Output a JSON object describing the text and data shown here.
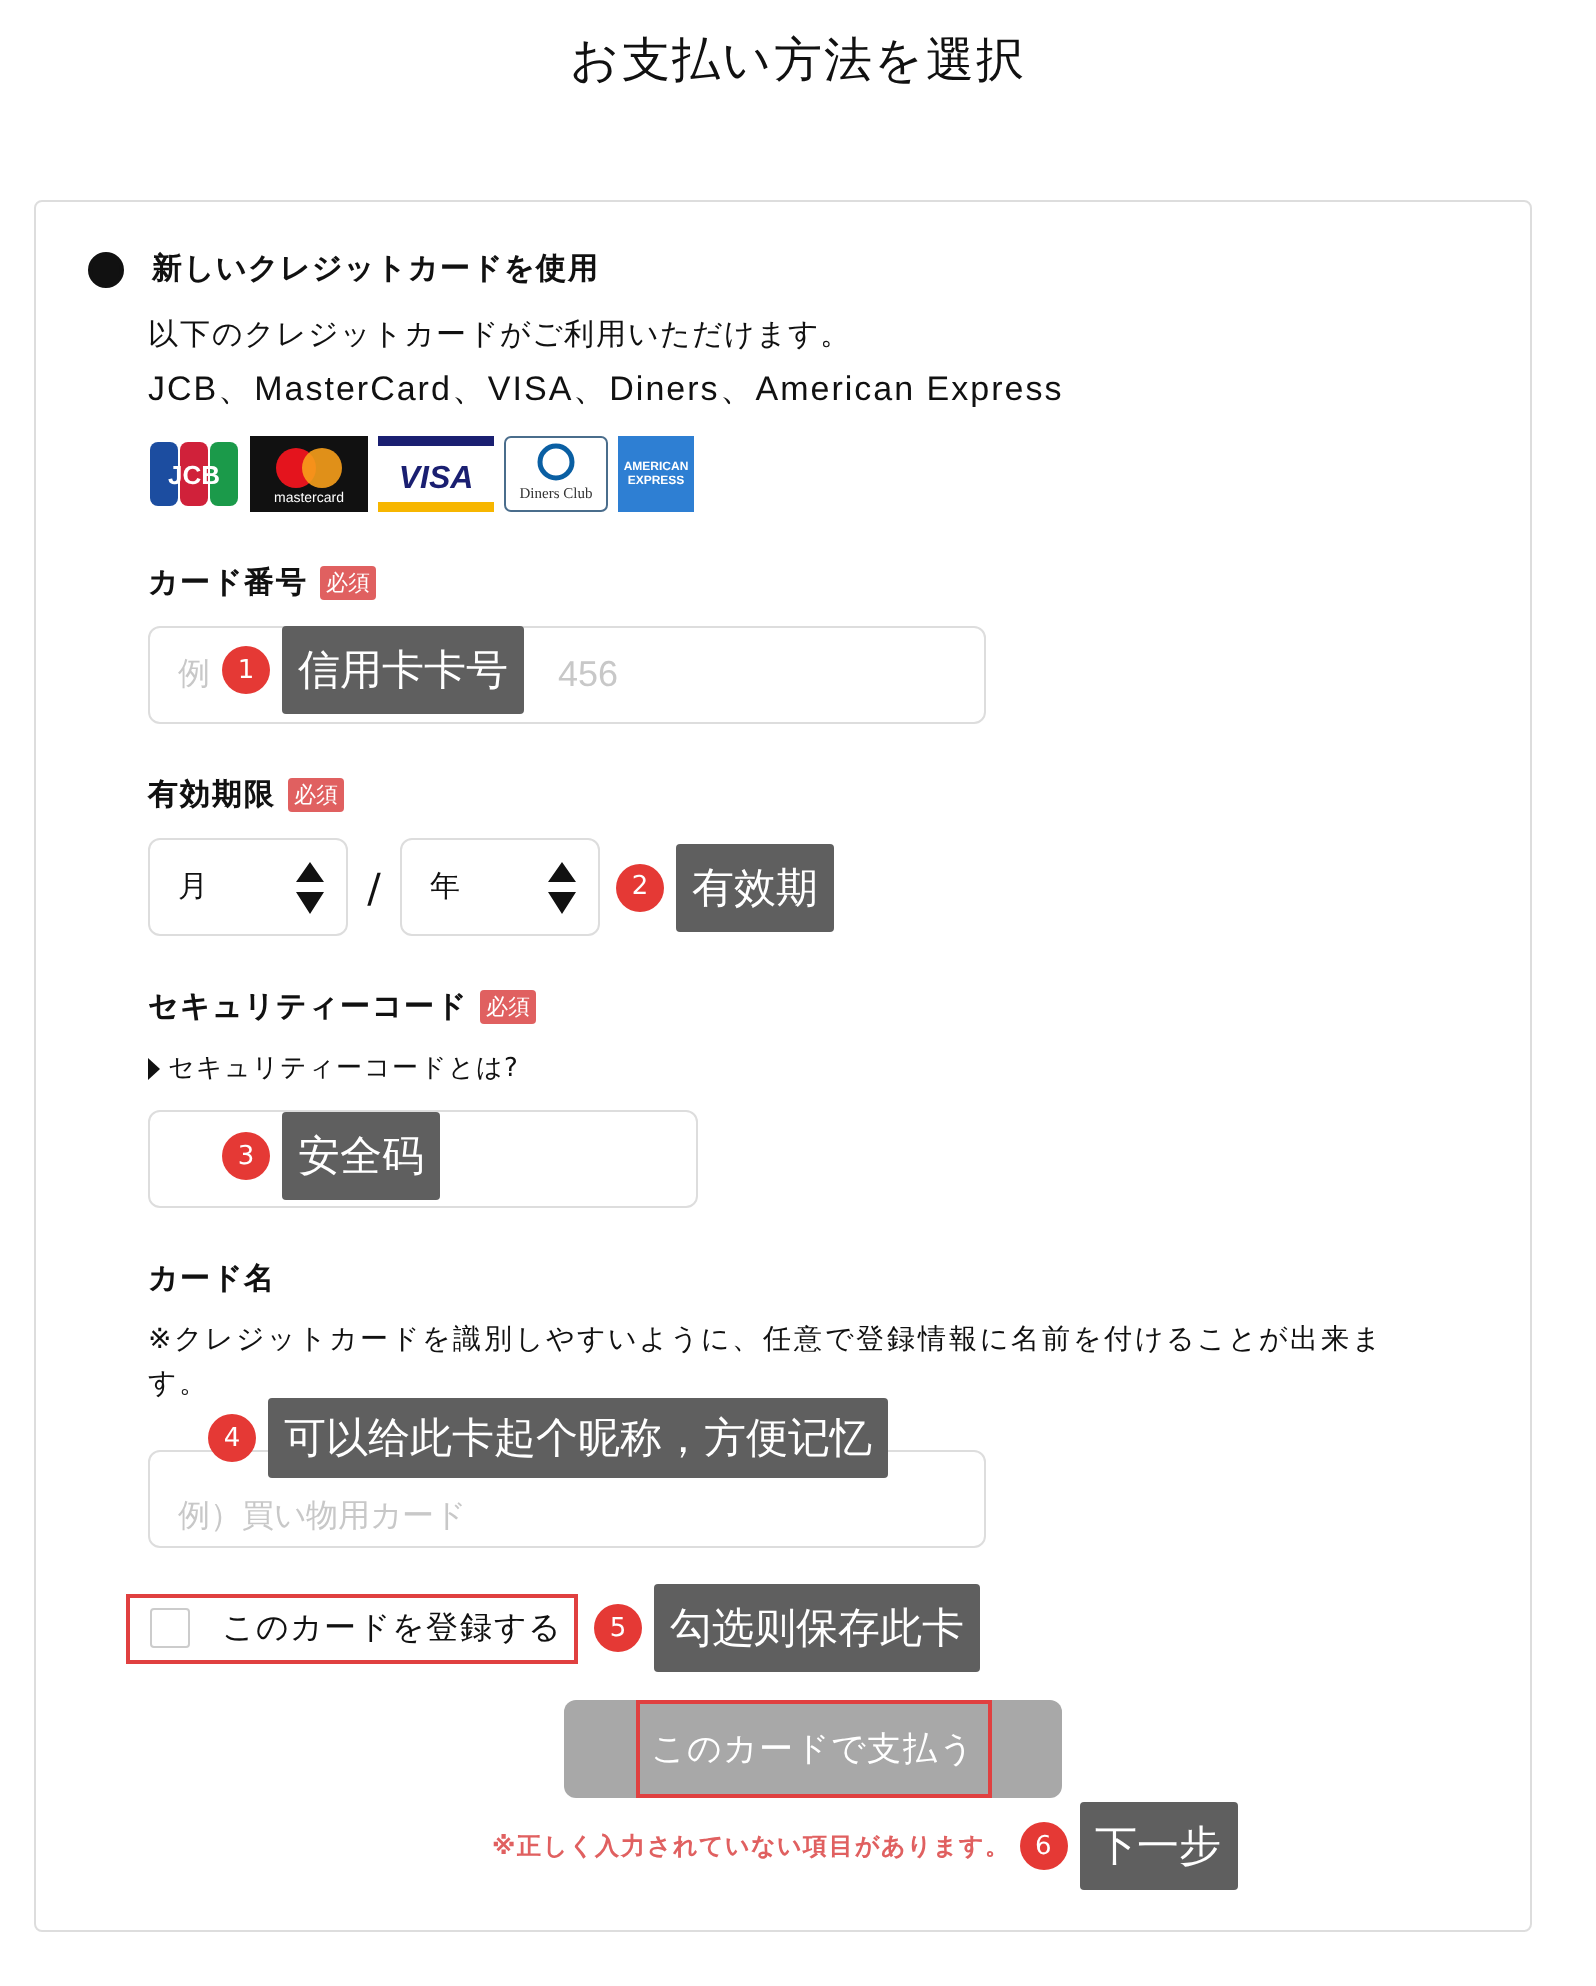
{
  "page_title": "お支払い方法を選択",
  "payment_option": {
    "label": "新しいクレジットカードを使用",
    "selected": true
  },
  "accepted_note": "以下のクレジットカードがご利用いただけます。",
  "accepted_brands": "JCB、MasterCard、VISA、Diners、American Express",
  "card_logos": [
    {
      "kind": "jcb",
      "text": "JCB"
    },
    {
      "kind": "mastercard",
      "text": "mastercard"
    },
    {
      "kind": "visa",
      "text": "VISA"
    },
    {
      "kind": "diners",
      "text": "Diners Club"
    },
    {
      "kind": "amex",
      "text": "AMERICAN EXPRESS"
    }
  ],
  "card_number": {
    "label": "カード番号",
    "badge": "必須",
    "placeholder_parts": [
      "例",
      "456"
    ]
  },
  "expiry": {
    "label": "有効期限",
    "badge": "必須",
    "month": "月",
    "separator": "/",
    "year": "年"
  },
  "security_code": {
    "label": "セキュリティーコード",
    "badge": "必須",
    "help_link": "セキュリティーコードとは?"
  },
  "card_name": {
    "label": "カード名",
    "note": "※クレジットカードを識別しやすいように、任意で登録情報に名前を付けることが出来ます。",
    "placeholder": "例）買い物用カード"
  },
  "save_card": {
    "label": "このカードを登録する",
    "checked": false
  },
  "pay_button": {
    "label": "このカードで支払う",
    "disabled": true
  },
  "error": "※正しく入力されていない項目があります。",
  "annotations": [
    {
      "number": "1",
      "text": "信用卡卡号"
    },
    {
      "number": "2",
      "text": "有效期"
    },
    {
      "number": "3",
      "text": "安全码"
    },
    {
      "number": "4",
      "text": "可以给此卡起个昵称，方便记忆"
    },
    {
      "number": "5",
      "text": "勾选则保存此卡"
    },
    {
      "number": "6",
      "text": "下一步"
    }
  ]
}
